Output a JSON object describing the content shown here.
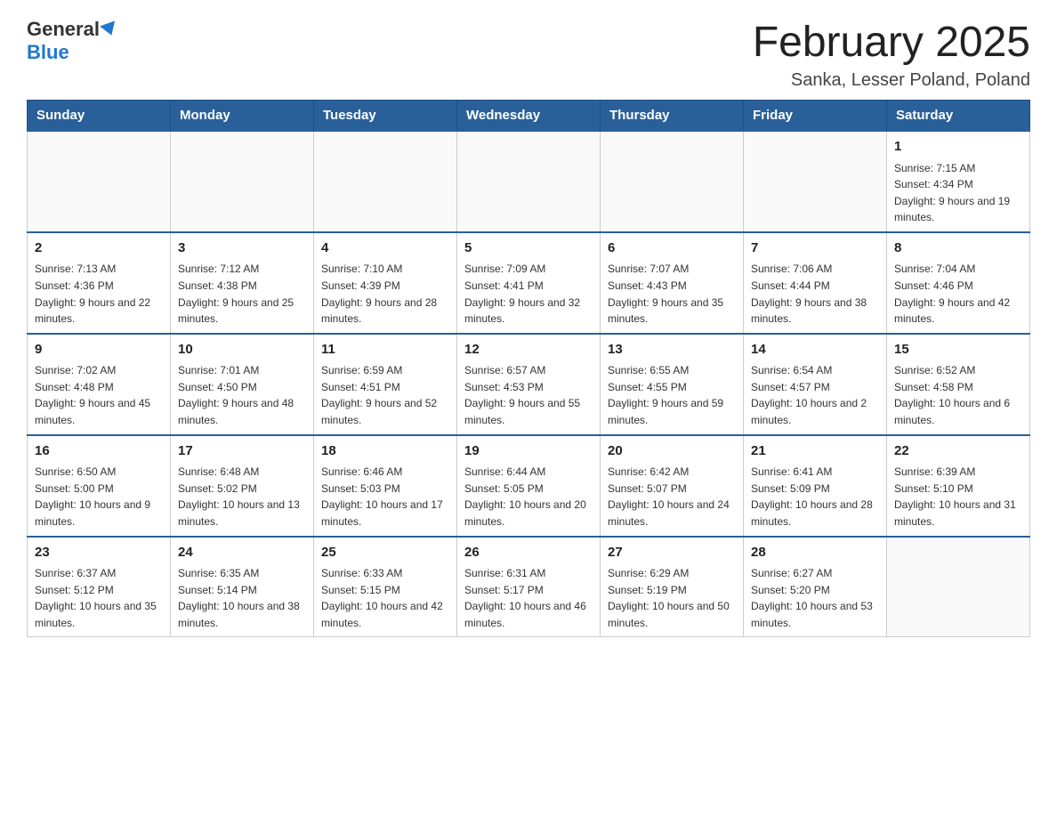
{
  "header": {
    "logo_general": "General",
    "logo_blue": "Blue",
    "title": "February 2025",
    "location": "Sanka, Lesser Poland, Poland"
  },
  "calendar": {
    "days_of_week": [
      "Sunday",
      "Monday",
      "Tuesday",
      "Wednesday",
      "Thursday",
      "Friday",
      "Saturday"
    ],
    "weeks": [
      [
        {
          "day": "",
          "info": ""
        },
        {
          "day": "",
          "info": ""
        },
        {
          "day": "",
          "info": ""
        },
        {
          "day": "",
          "info": ""
        },
        {
          "day": "",
          "info": ""
        },
        {
          "day": "",
          "info": ""
        },
        {
          "day": "1",
          "info": "Sunrise: 7:15 AM\nSunset: 4:34 PM\nDaylight: 9 hours and 19 minutes."
        }
      ],
      [
        {
          "day": "2",
          "info": "Sunrise: 7:13 AM\nSunset: 4:36 PM\nDaylight: 9 hours and 22 minutes."
        },
        {
          "day": "3",
          "info": "Sunrise: 7:12 AM\nSunset: 4:38 PM\nDaylight: 9 hours and 25 minutes."
        },
        {
          "day": "4",
          "info": "Sunrise: 7:10 AM\nSunset: 4:39 PM\nDaylight: 9 hours and 28 minutes."
        },
        {
          "day": "5",
          "info": "Sunrise: 7:09 AM\nSunset: 4:41 PM\nDaylight: 9 hours and 32 minutes."
        },
        {
          "day": "6",
          "info": "Sunrise: 7:07 AM\nSunset: 4:43 PM\nDaylight: 9 hours and 35 minutes."
        },
        {
          "day": "7",
          "info": "Sunrise: 7:06 AM\nSunset: 4:44 PM\nDaylight: 9 hours and 38 minutes."
        },
        {
          "day": "8",
          "info": "Sunrise: 7:04 AM\nSunset: 4:46 PM\nDaylight: 9 hours and 42 minutes."
        }
      ],
      [
        {
          "day": "9",
          "info": "Sunrise: 7:02 AM\nSunset: 4:48 PM\nDaylight: 9 hours and 45 minutes."
        },
        {
          "day": "10",
          "info": "Sunrise: 7:01 AM\nSunset: 4:50 PM\nDaylight: 9 hours and 48 minutes."
        },
        {
          "day": "11",
          "info": "Sunrise: 6:59 AM\nSunset: 4:51 PM\nDaylight: 9 hours and 52 minutes."
        },
        {
          "day": "12",
          "info": "Sunrise: 6:57 AM\nSunset: 4:53 PM\nDaylight: 9 hours and 55 minutes."
        },
        {
          "day": "13",
          "info": "Sunrise: 6:55 AM\nSunset: 4:55 PM\nDaylight: 9 hours and 59 minutes."
        },
        {
          "day": "14",
          "info": "Sunrise: 6:54 AM\nSunset: 4:57 PM\nDaylight: 10 hours and 2 minutes."
        },
        {
          "day": "15",
          "info": "Sunrise: 6:52 AM\nSunset: 4:58 PM\nDaylight: 10 hours and 6 minutes."
        }
      ],
      [
        {
          "day": "16",
          "info": "Sunrise: 6:50 AM\nSunset: 5:00 PM\nDaylight: 10 hours and 9 minutes."
        },
        {
          "day": "17",
          "info": "Sunrise: 6:48 AM\nSunset: 5:02 PM\nDaylight: 10 hours and 13 minutes."
        },
        {
          "day": "18",
          "info": "Sunrise: 6:46 AM\nSunset: 5:03 PM\nDaylight: 10 hours and 17 minutes."
        },
        {
          "day": "19",
          "info": "Sunrise: 6:44 AM\nSunset: 5:05 PM\nDaylight: 10 hours and 20 minutes."
        },
        {
          "day": "20",
          "info": "Sunrise: 6:42 AM\nSunset: 5:07 PM\nDaylight: 10 hours and 24 minutes."
        },
        {
          "day": "21",
          "info": "Sunrise: 6:41 AM\nSunset: 5:09 PM\nDaylight: 10 hours and 28 minutes."
        },
        {
          "day": "22",
          "info": "Sunrise: 6:39 AM\nSunset: 5:10 PM\nDaylight: 10 hours and 31 minutes."
        }
      ],
      [
        {
          "day": "23",
          "info": "Sunrise: 6:37 AM\nSunset: 5:12 PM\nDaylight: 10 hours and 35 minutes."
        },
        {
          "day": "24",
          "info": "Sunrise: 6:35 AM\nSunset: 5:14 PM\nDaylight: 10 hours and 38 minutes."
        },
        {
          "day": "25",
          "info": "Sunrise: 6:33 AM\nSunset: 5:15 PM\nDaylight: 10 hours and 42 minutes."
        },
        {
          "day": "26",
          "info": "Sunrise: 6:31 AM\nSunset: 5:17 PM\nDaylight: 10 hours and 46 minutes."
        },
        {
          "day": "27",
          "info": "Sunrise: 6:29 AM\nSunset: 5:19 PM\nDaylight: 10 hours and 50 minutes."
        },
        {
          "day": "28",
          "info": "Sunrise: 6:27 AM\nSunset: 5:20 PM\nDaylight: 10 hours and 53 minutes."
        },
        {
          "day": "",
          "info": ""
        }
      ]
    ]
  }
}
